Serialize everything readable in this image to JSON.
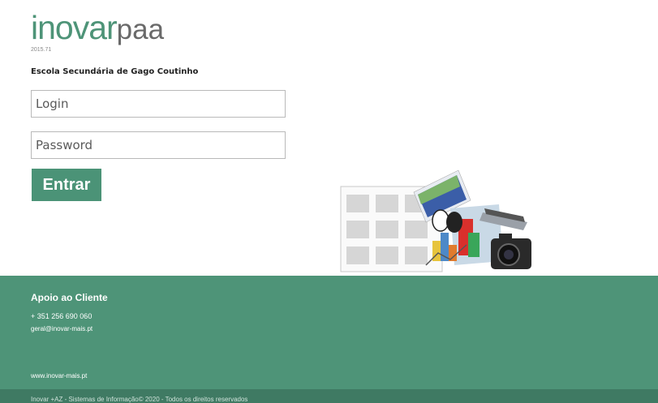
{
  "brand": {
    "logo_primary": "inovar",
    "logo_secondary": "paa",
    "version": "2015.71"
  },
  "school_name": "Escola Secundária de Gago Coutinho",
  "form": {
    "login_placeholder": "Login",
    "password_placeholder": "Password",
    "submit_label": "Entrar"
  },
  "footer": {
    "title": "Apoio ao Cliente",
    "phone": "+ 351 256 690 060",
    "email": "geral@inovar-mais.pt",
    "website": "www.inovar-mais.pt",
    "copyright": "Inovar +AZ - Sistemas de Informação© 2020 - Todos os direitos reservados"
  },
  "colors": {
    "brand_green": "#4e9478",
    "button_green": "#4b9377",
    "footer_dark": "#3f7a63"
  }
}
